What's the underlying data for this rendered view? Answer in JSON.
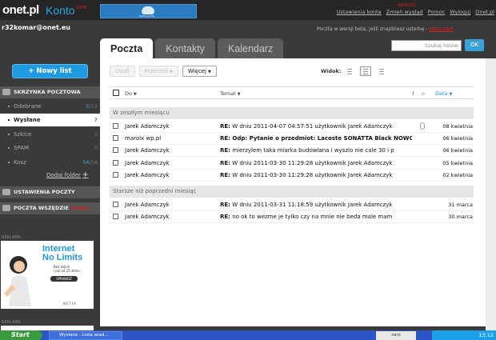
{
  "header": {
    "logo": "onet.pl",
    "product": "Konto",
    "beta_tag": "BETA",
    "banner_text": "Konto poczty",
    "links": [
      "Ustawienia konta",
      "Zmień wygląd",
      "Pomoc",
      "Wyloguj",
      "Onet.pl"
    ],
    "new_flag": "NOWOŚĆ",
    "user": "r32komar@onet.eu",
    "beta_info": "Poczta w wersji beta, jeśli znajdziesz usterkę - ",
    "beta_link": "zgłoś nam"
  },
  "tabs": [
    "Poczta",
    "Kontakty",
    "Kalendarz"
  ],
  "search": {
    "placeholder": "Szukaj listów",
    "ok": "OK"
  },
  "sidebar": {
    "new_mail": "Nowy list",
    "mailbox_header": "SKRZYNKA POCZTOWA",
    "folders": [
      {
        "name": "Odebrane",
        "count_new": "5",
        "count_total": "/12"
      },
      {
        "name": "Wysłane",
        "count_new": "",
        "count_total": "7"
      },
      {
        "name": "Szkice",
        "count_new": "",
        "count_total": "0"
      },
      {
        "name": "SPAM",
        "count_new": "",
        "count_total": "0"
      },
      {
        "name": "Kosz",
        "count_new": "54",
        "count_total": "/56"
      }
    ],
    "add_folder": "Dodaj folder",
    "settings": "USTAWIENIA POCZTY",
    "everywhere": "POCZTA WSZĘDZIE",
    "new_badge": "NOWOŚĆ",
    "ad_label": "REKLAMA"
  },
  "ad": {
    "line1": "Internet",
    "line2": "No Limits",
    "sub1": "Bez kojkili",
    "sub2": "i już od 25 zł/mc.",
    "button": "SPRAWDŹ",
    "brand": "NETIA"
  },
  "toolbar": {
    "delete": "Usuń",
    "move": "Przenieś",
    "more": "Więcej",
    "view": "Widok:"
  },
  "columns": {
    "from": "Do",
    "subject": "Temat",
    "date": "Data"
  },
  "groups": [
    {
      "label": "W zeszłym miesiącu",
      "rows": [
        {
          "from": "Jarek Adamczyk",
          "prefix": "RE:",
          "subject": " W dniu 2011-04-07 04:57:51 użytkownik Jarek Adamczyk",
          "date": "08 kwietnia",
          "attach": true
        },
        {
          "from": "marolx wp.pl",
          "prefix": "RE:",
          "subject": " Odp: Pytanie o przedmiot: Lacoste SONATTA Black NOWC",
          "date": "06 kwietnia",
          "attach": false
        },
        {
          "from": "Jarek Adamczyk",
          "prefix": "RE:",
          "subject": " mierzylem taka miarka budowlana i wyszlo nie cale 30 i p",
          "date": "06 kwietnia",
          "attach": false
        },
        {
          "from": "Jarek Adamczyk",
          "prefix": "RE:",
          "subject": " W dniu 2011-03-30 11:29:28 użytkownik Jarek Adamczyk",
          "date": "05 kwietnia",
          "attach": false
        },
        {
          "from": "Jarek Adamczyk",
          "prefix": "RE:",
          "subject": " W dniu 2011-03-30 11:29:28 użytkownik Jarek Adamczyk",
          "date": "02 kwietnia",
          "attach": false
        }
      ]
    },
    {
      "label": "Starsze niż poprzedni miesiąc",
      "rows": [
        {
          "from": "Jarek Adamczyk",
          "prefix": "RE:",
          "subject": " W dniu 2011-03-31 11:18:59 użytkownik Jarek Adamczyk",
          "date": "31 marca",
          "attach": false
        },
        {
          "from": "Jarek Adamczyk",
          "prefix": "RE:",
          "subject": " no ok to wezme je tylko czy na mnie nie beda male mam",
          "date": "30 marca",
          "attach": false
        }
      ]
    }
  ],
  "taskbar": {
    "start": "Start",
    "task": "Wysłane - Lista wiad...",
    "nero": "nero",
    "clock": "13:12"
  }
}
